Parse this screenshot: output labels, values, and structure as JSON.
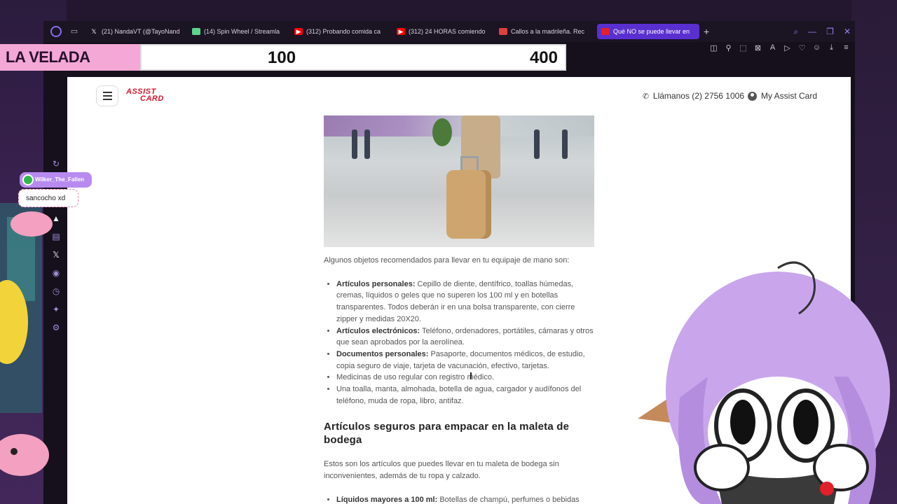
{
  "browser": {
    "tabs": [
      {
        "label": "(21) NandaVT (@TayoNand",
        "icon": "x-logo-icon",
        "color": "#ffffff"
      },
      {
        "label": "(14) Spin Wheel / Streamla",
        "icon": "wheel-icon",
        "color": "#58d68d"
      },
      {
        "label": "(312) Probando comida ca",
        "icon": "youtube-icon",
        "color": "#ff0000"
      },
      {
        "label": "(312) 24 HORAS comiendo",
        "icon": "youtube-icon",
        "color": "#ff0000"
      },
      {
        "label": "Callos a la madrileña. Rec",
        "icon": "recipe-icon",
        "color": "#e04040"
      },
      {
        "label": "Qué NO se puede llevar en",
        "icon": "assist-card-icon",
        "color": "#e0202a",
        "active": true
      }
    ],
    "accent": "#5a2fd0"
  },
  "overlay": {
    "title": "LA VELADA",
    "score_left": "100",
    "score_right": "400"
  },
  "chat": {
    "user": "Wilker_The_Fallen",
    "message": "sancocho xd"
  },
  "site": {
    "logo_line1": "ASSIST",
    "logo_line2": "CARD",
    "call_label": "Llámanos (2) 2756 1006",
    "account_label": "My Assist Card",
    "brand_color": "#d6142a"
  },
  "article": {
    "intro": "Algunos objetos recomendados para llevar en tu equipaje de mano son:",
    "carry_on": [
      {
        "bold": "Artículos personales:",
        "text": " Cepillo de diente, dentífrico, toallas húmedas, cremas, líquidos o geles que no superen los 100 ml y en botellas transparentes. Todos deberán ir en una bolsa transparente, con cierre zipper y medidas 20X20."
      },
      {
        "bold": "Artículos electrónicos:",
        "text": " Teléfono, ordenadores, portátiles, cámaras y otros que sean aprobados por la aerolínea."
      },
      {
        "bold": "Documentos personales:",
        "text": " Pasaporte, documentos médicos, de estudio, copia seguro de viaje, tarjeta de vacunación, efectivo, tarjetas."
      },
      {
        "bold": "",
        "text": "Medicinas de uso regular con registro médico."
      },
      {
        "bold": "",
        "text": "Una toalla, manta, almohada, botella de agua, cargador y audífonos del teléfono, muda de ropa, libro, antifaz."
      }
    ],
    "heading": "Artículos seguros para empacar en la maleta de bodega",
    "para2": "Estos son los artículos que puedes llevar en tu maleta de bodega sin inconvenientes, además de tu ropa y calzado.",
    "checked": [
      {
        "bold": "Líquidos mayores a 100 ml:",
        "text": " Botellas de champú, perfumes o bebidas cerradas/selladas para evitar derrames. En el caso de bebidas alcohólicas, la"
      }
    ]
  }
}
